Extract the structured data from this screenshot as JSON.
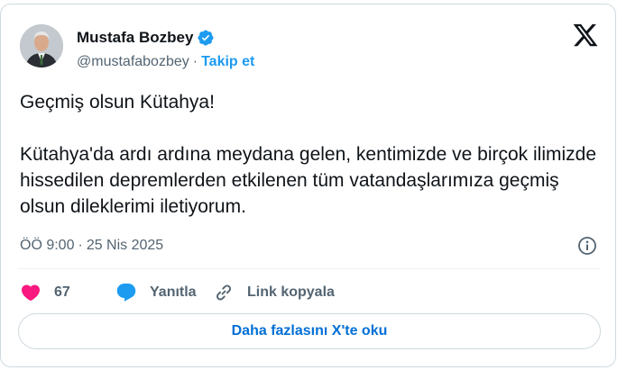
{
  "author": {
    "name": "Mustafa Bozbey",
    "handle": "@mustafabozbey",
    "separator": "·",
    "follow_label": "Takip et"
  },
  "icons": {
    "verified": "verified-badge-icon",
    "brand": "x-logo-icon",
    "info": "info-icon",
    "like": "heart-icon",
    "reply": "reply-bubble-icon",
    "copy": "link-icon"
  },
  "tweet": {
    "text": "Geçmiş olsun Kütahya!\n\nKütahya'da ardı ardına meydana gelen, kentimizde ve birçok ilimizde hissedilen depremlerden etkilenen tüm vatandaşlarımıza geçmiş olsun dileklerimi iletiyorum.",
    "time": "ÖÖ 9:00",
    "date": "25 Nis 2025",
    "separator": "·"
  },
  "actions": {
    "like_count": "67",
    "reply_label": "Yanıtla",
    "copy_label": "Link kopyala"
  },
  "read_more_label": "Daha fazlasını X'te oku",
  "colors": {
    "accent": "#1d9bf0",
    "like": "#f91880",
    "text": "#0f1419",
    "muted": "#536471",
    "border": "#cfd9de",
    "read_more": "#006fd6"
  }
}
